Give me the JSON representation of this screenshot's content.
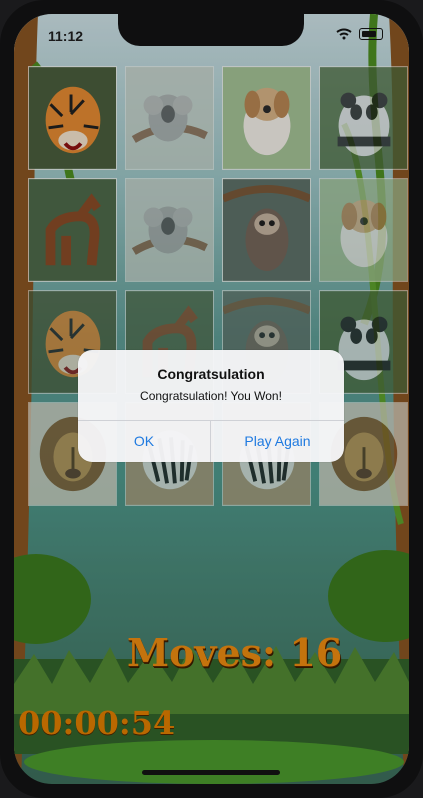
{
  "status_bar": {
    "time": "11:12"
  },
  "game": {
    "moves_label": "Moves: 16",
    "timer": "00:00:54",
    "cards": [
      {
        "animal": "tiger"
      },
      {
        "animal": "koala"
      },
      {
        "animal": "dog"
      },
      {
        "animal": "panda"
      },
      {
        "animal": "horse"
      },
      {
        "animal": "koala"
      },
      {
        "animal": "sloth"
      },
      {
        "animal": "dog"
      },
      {
        "animal": "tiger"
      },
      {
        "animal": "horse"
      },
      {
        "animal": "sloth"
      },
      {
        "animal": "panda"
      },
      {
        "animal": "lion"
      },
      {
        "animal": "zebra"
      },
      {
        "animal": "zebra"
      },
      {
        "animal": "lion"
      }
    ]
  },
  "dialog": {
    "title": "Congratsulation",
    "message": "Congratsulation! You Won!",
    "ok_label": "OK",
    "play_again_label": "Play Again"
  },
  "colors": {
    "accent": "#1f7ae0",
    "moves_text": "#ef8d11",
    "timer_text": "#e27f00"
  }
}
